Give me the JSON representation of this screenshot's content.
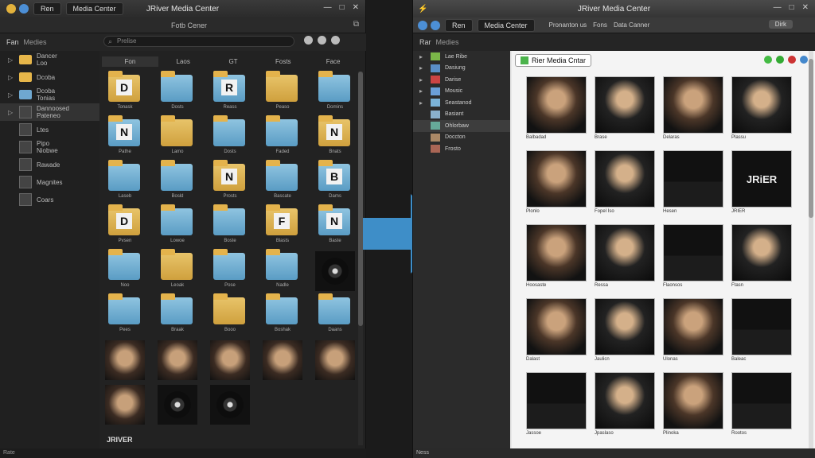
{
  "left_window": {
    "title": "JRiver Media Center",
    "tab1": "Ren",
    "tab2": "Media Center",
    "mid_label": "Fotb Cener",
    "search_placeholder": "Prelise",
    "header_a": "Fan",
    "header_b": "Medies",
    "columns": [
      "Fon",
      "Laos",
      "GT",
      "Fosts",
      "Face"
    ],
    "sidebar": [
      {
        "label": "Dancer\nLoo",
        "icon": "folder"
      },
      {
        "label": "Dcoba",
        "icon": "folder"
      },
      {
        "label": "Dcoba\nTonias",
        "icon": "folder-blue"
      },
      {
        "label": "Dannoosed\nPateneo",
        "icon": "photo"
      },
      {
        "label": "Ltes",
        "icon": "photo"
      },
      {
        "label": "Pipo\nNiobwe",
        "icon": "photo"
      },
      {
        "label": "Rawade",
        "icon": "photo"
      },
      {
        "label": "Magnites",
        "icon": "photo"
      },
      {
        "label": "Coars",
        "icon": "photo"
      }
    ],
    "grid": [
      {
        "kind": "folder",
        "letter": "D",
        "label": "Tonask"
      },
      {
        "kind": "folder",
        "letter": "",
        "label": "Dosts"
      },
      {
        "kind": "folder",
        "letter": "R",
        "label": "Reass"
      },
      {
        "kind": "folder",
        "letter": "",
        "label": "Peaso"
      },
      {
        "kind": "folder",
        "letter": "",
        "label": "Domins"
      },
      {
        "kind": "folder",
        "letter": "N",
        "label": "Pathe"
      },
      {
        "kind": "folder",
        "letter": "",
        "label": "Lamo"
      },
      {
        "kind": "folder",
        "letter": "",
        "label": "Dosts"
      },
      {
        "kind": "folder",
        "letter": "",
        "label": "Faded"
      },
      {
        "kind": "folder",
        "letter": "N",
        "label": "Bnats"
      },
      {
        "kind": "folder",
        "letter": "",
        "label": "Laseb"
      },
      {
        "kind": "folder",
        "letter": "",
        "label": "Bosld"
      },
      {
        "kind": "folder",
        "letter": "N",
        "label": "Prosts"
      },
      {
        "kind": "folder",
        "letter": "",
        "label": "Bascate"
      },
      {
        "kind": "folder",
        "letter": "B",
        "label": "Dams"
      },
      {
        "kind": "folder",
        "letter": "D",
        "label": "Pvsen"
      },
      {
        "kind": "folder",
        "letter": "",
        "label": "Lowoe"
      },
      {
        "kind": "folder",
        "letter": "",
        "label": "Boste"
      },
      {
        "kind": "folder",
        "letter": "F",
        "label": "Blasts"
      },
      {
        "kind": "folder",
        "letter": "N",
        "label": "Baste"
      },
      {
        "kind": "folder",
        "letter": "",
        "label": "Noo"
      },
      {
        "kind": "folder",
        "letter": "",
        "label": "Leoak"
      },
      {
        "kind": "folder",
        "letter": "",
        "label": "Pose"
      },
      {
        "kind": "folder",
        "letter": "",
        "label": "Nadle"
      },
      {
        "kind": "disc",
        "letter": "",
        "label": ""
      },
      {
        "kind": "folder",
        "letter": "",
        "label": "Pees"
      },
      {
        "kind": "folder",
        "letter": "",
        "label": "Braak"
      },
      {
        "kind": "folder",
        "letter": "",
        "label": "Booo"
      },
      {
        "kind": "folder",
        "letter": "",
        "label": "Boshak"
      },
      {
        "kind": "folder",
        "letter": "",
        "label": "Daans"
      },
      {
        "kind": "photo",
        "letter": "",
        "label": ""
      },
      {
        "kind": "photo",
        "letter": "",
        "label": ""
      },
      {
        "kind": "photo",
        "letter": "",
        "label": ""
      },
      {
        "kind": "photo",
        "letter": "",
        "label": ""
      },
      {
        "kind": "photo",
        "letter": "",
        "label": ""
      },
      {
        "kind": "photo",
        "letter": "",
        "label": ""
      },
      {
        "kind": "disc",
        "letter": "",
        "label": ""
      },
      {
        "kind": "disc",
        "letter": "",
        "label": ""
      }
    ],
    "bottom_label": "JRIVER",
    "status": "Rate"
  },
  "right_window": {
    "title": "JRiver Media Center",
    "tab1": "Ren",
    "tab2": "Media Center",
    "tb_a": "Pronanton us",
    "tb_b": "Fons",
    "tb_c": "Data Canner",
    "tb_d": "Dirk",
    "header_a": "Rar",
    "header_b": "Medies",
    "main_title": "Rier Media Cntar",
    "sidebar": [
      {
        "label": "Lae Ribe",
        "color": "#7ab648"
      },
      {
        "label": "Dasiung",
        "color": "#5a8fc8"
      },
      {
        "label": "Darise",
        "color": "#c44"
      },
      {
        "label": "Mousic",
        "color": "#6b9fd8"
      },
      {
        "label": "Seastanod",
        "color": "#7bb3d8"
      },
      {
        "label": "Basiant",
        "color": "#8ab0cc"
      },
      {
        "label": "Ohlorbaw",
        "color": "#6a9"
      },
      {
        "label": "Doccton",
        "color": "#a86"
      },
      {
        "label": "Frosto",
        "color": "#a65"
      }
    ],
    "grid": [
      {
        "cap": "Balbadad",
        "style": ""
      },
      {
        "cap": "Brase",
        "style": "dark"
      },
      {
        "cap": "Delaras",
        "style": ""
      },
      {
        "cap": "Plassu",
        "style": "dark"
      },
      {
        "cap": "Plonlo",
        "style": ""
      },
      {
        "cap": "Fopel Iso",
        "style": "dark"
      },
      {
        "cap": "Hesen",
        "style": "suit"
      },
      {
        "cap": "JRIER",
        "style": "logo"
      },
      {
        "cap": "Hoosaste",
        "style": ""
      },
      {
        "cap": "Ressa",
        "style": "dark"
      },
      {
        "cap": "Flaonsos",
        "style": "suit"
      },
      {
        "cap": "Ftasn",
        "style": "dark"
      },
      {
        "cap": "Dalast",
        "style": ""
      },
      {
        "cap": "Jaulicn",
        "style": "dark"
      },
      {
        "cap": "Ulonas",
        "style": ""
      },
      {
        "cap": "Baleac",
        "style": "suit"
      },
      {
        "cap": "Jassoe",
        "style": "suit"
      },
      {
        "cap": "Jpaslaso",
        "style": "dark"
      },
      {
        "cap": "Plinoka",
        "style": ""
      },
      {
        "cap": "Rootos",
        "style": "suit"
      }
    ],
    "status": "Ness"
  }
}
